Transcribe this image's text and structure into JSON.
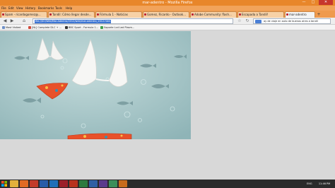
{
  "window": {
    "title": "mar-adentro - Mozilla Firefox",
    "min_glyph": "—",
    "max_glyph": "□",
    "close_glyph": "✕"
  },
  "menu": {
    "items": [
      "File",
      "Edit",
      "View",
      "History",
      "Bookmarks",
      "Tools",
      "Help"
    ]
  },
  "tabs": [
    {
      "label": "Spam - ricardogomez@..."
    },
    {
      "label": "Tandil: Cómo llegar desde..."
    },
    {
      "label": "Fórmula 1 - Noticias"
    },
    {
      "label": "Gomez, Ricardo - Outlook..."
    },
    {
      "label": "Adobe Community: flash..."
    },
    {
      "label": "Escapada a Tandil!"
    },
    {
      "label": "mar-adentro"
    }
  ],
  "newtab_glyph": "+",
  "nav": {
    "back_glyph": "◀",
    "forward_glyph": "▶",
    "home_glyph": "⌂",
    "url": "file:///D:/Web/Mar-Adentro/2012/web/mar-adentro_2012.html",
    "star_glyph": "☆",
    "reload_glyph": "↻",
    "search_value": "ay de viaje en auto de buenos aires a tandil"
  },
  "bookmarks": [
    {
      "label": "Most Visited",
      "color": "#6d8fc7"
    },
    {
      "label": "[NL] Complete DLC + ...",
      "color": "#d04a3b"
    },
    {
      "label": "BBC Sport - Formula 1...",
      "color": "#333333"
    },
    {
      "label": "Soporte Lcd Led Plasm...",
      "color": "#3fa04a"
    }
  ],
  "taskbar": {
    "apps": [
      {
        "name": "explorer-icon",
        "color": "#e2b13c"
      },
      {
        "name": "firefox-icon",
        "color": "#e06b24"
      },
      {
        "name": "media-icon",
        "color": "#c23b2a"
      },
      {
        "name": "photoshop-icon",
        "color": "#2a5ca8"
      },
      {
        "name": "outlook-icon",
        "color": "#1f6fb8"
      },
      {
        "name": "flash-icon",
        "color": "#9b1f2a"
      },
      {
        "name": "acrobat-icon",
        "color": "#b8321e"
      },
      {
        "name": "excel-icon",
        "color": "#2d7a3d"
      },
      {
        "name": "word-icon",
        "color": "#2f5fa3"
      },
      {
        "name": "premiere-icon",
        "color": "#5a3a8c"
      },
      {
        "name": "dreamweaver-icon",
        "color": "#3c8f5a"
      },
      {
        "name": "illustrator-icon",
        "color": "#c76b1d"
      }
    ],
    "lang": "ENG",
    "clock": "11:46 PM"
  },
  "colors": {
    "titlebar": "#e8862a",
    "image_bg": "#a8c6c8",
    "bikini_white": "#f4f4f2",
    "bikini_orange": "#e8512a"
  }
}
